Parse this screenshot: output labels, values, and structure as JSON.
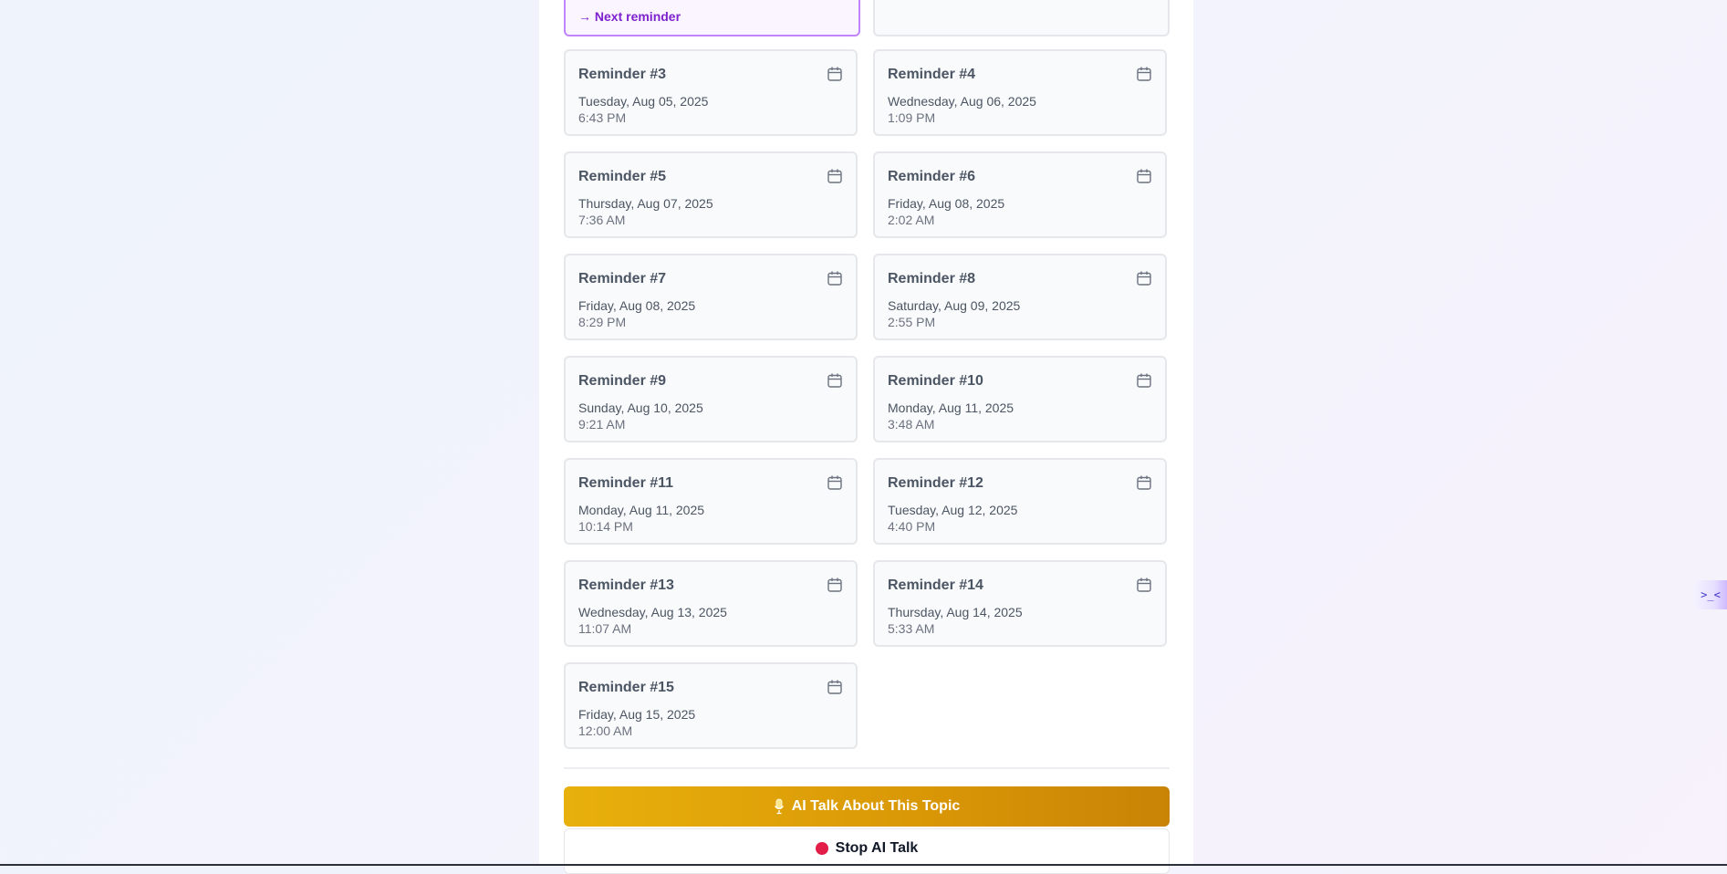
{
  "next_reminder": {
    "label": "→ Next reminder"
  },
  "reminders": [
    {
      "title": "Reminder #3",
      "date": "Tuesday, Aug 05, 2025",
      "time": "6:43 PM"
    },
    {
      "title": "Reminder #4",
      "date": "Wednesday, Aug 06, 2025",
      "time": "1:09 PM"
    },
    {
      "title": "Reminder #5",
      "date": "Thursday, Aug 07, 2025",
      "time": "7:36 AM"
    },
    {
      "title": "Reminder #6",
      "date": "Friday, Aug 08, 2025",
      "time": "2:02 AM"
    },
    {
      "title": "Reminder #7",
      "date": "Friday, Aug 08, 2025",
      "time": "8:29 PM"
    },
    {
      "title": "Reminder #8",
      "date": "Saturday, Aug 09, 2025",
      "time": "2:55 PM"
    },
    {
      "title": "Reminder #9",
      "date": "Sunday, Aug 10, 2025",
      "time": "9:21 AM"
    },
    {
      "title": "Reminder #10",
      "date": "Monday, Aug 11, 2025",
      "time": "3:48 AM"
    },
    {
      "title": "Reminder #11",
      "date": "Monday, Aug 11, 2025",
      "time": "10:14 PM"
    },
    {
      "title": "Reminder #12",
      "date": "Tuesday, Aug 12, 2025",
      "time": "4:40 PM"
    },
    {
      "title": "Reminder #13",
      "date": "Wednesday, Aug 13, 2025",
      "time": "11:07 AM"
    },
    {
      "title": "Reminder #14",
      "date": "Thursday, Aug 14, 2025",
      "time": "5:33 AM"
    },
    {
      "title": "Reminder #15",
      "date": "Friday, Aug 15, 2025",
      "time": "12:00 AM"
    }
  ],
  "actions": {
    "ai_talk_label": "AI Talk About This Topic",
    "ai_talk_icon": "microphone-icon",
    "stop_label": "Stop AI Talk",
    "stop_icon": "red-circle-icon"
  },
  "side_tab": {
    "glyph": ">_<"
  },
  "colors": {
    "accent_gold": "#d99706",
    "next_purple": "#7e22ce",
    "stop_red": "#e11d48"
  }
}
